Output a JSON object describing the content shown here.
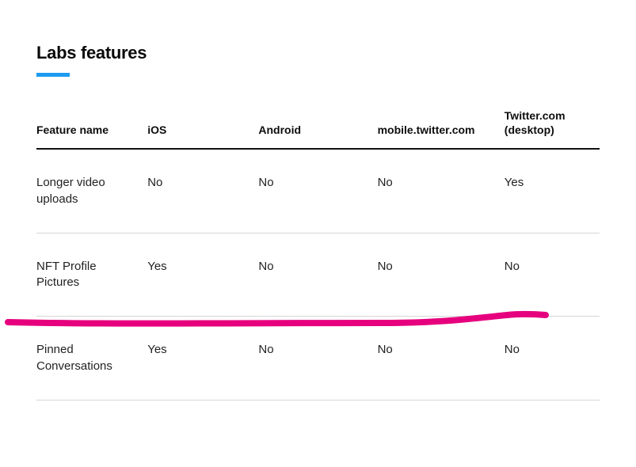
{
  "heading": "Labs features",
  "columns": {
    "c1": "Feature name",
    "c2": "iOS",
    "c3": "Android",
    "c4": "mobile.twitter.com",
    "c5": "Twitter.com (desktop)"
  },
  "rows": [
    {
      "name": "Longer video uploads",
      "ios": "No",
      "android": "No",
      "mobile": "No",
      "desktop": "Yes"
    },
    {
      "name": "NFT Profile Pictures",
      "ios": "Yes",
      "android": "No",
      "mobile": "No",
      "desktop": "No"
    },
    {
      "name": "Pinned Conversations",
      "ios": "Yes",
      "android": "No",
      "mobile": "No",
      "desktop": "No"
    }
  ],
  "chart_data": {
    "type": "table",
    "title": "Labs features",
    "columns": [
      "Feature name",
      "iOS",
      "Android",
      "mobile.twitter.com",
      "Twitter.com (desktop)"
    ],
    "data": [
      [
        "Longer video uploads",
        "No",
        "No",
        "No",
        "Yes"
      ],
      [
        "NFT Profile Pictures",
        "Yes",
        "No",
        "No",
        "No"
      ],
      [
        "Pinned Conversations",
        "Yes",
        "No",
        "No",
        "No"
      ]
    ],
    "highlighted_row_index": 1
  }
}
